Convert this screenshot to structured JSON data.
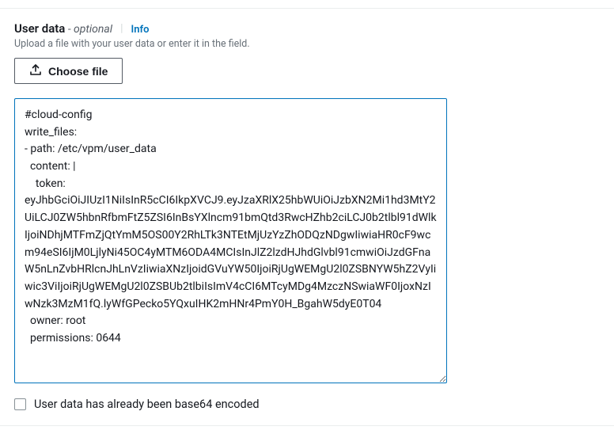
{
  "field": {
    "label": "User data",
    "optional": "- optional",
    "info": "Info",
    "description": "Upload a file with your user data or enter it in the field."
  },
  "choose_file": {
    "label": "Choose file"
  },
  "textarea": {
    "value": "#cloud-config\nwrite_files:\n- path: /etc/vpm/user_data\n  content: |\n    token: eyJhbGciOiJIUzI1NiIsInR5cCI6IkpXVCJ9.eyJzaXRlX25hbWUiOiJzbXN2Mi1hd3MtY2UiLCJ0ZW5hbnRfbmFtZ5ZSI6InBsYXlncm91bmQtd3RwcHZhb2ciLCJ0b2tlbl91dWlkIjoiNDhjMTFmZjQtYmM5OS00Y2RhLTk3NTEtMjUzYzZhODQzNDgwIiwiaHR0cF9wcm94eSI6IjM0LjlyNi45OC4yMTM6ODA4MCIsInJlZ2lzdHJhdGlvbl91cmwiOiJzdGFnaW5nLnZvbHRlcnJhLnVzIiwiaXNzIjoidGVuYW50IjoiRjUgWEMgU2l0ZSBNYW5hZ2VyIiwic3ViIjoiRjUgWEMgU2l0ZSBUb2tlbiIsImV4cCI6MTcyMDg4MzczNSwiaWF0IjoxNzIwNzk3MzM1fQ.lyWfGPecko5YQxuIHK2mHNr4PmY0H_BgahW5dyE0T04\n  owner: root\n  permissions: 0644"
  },
  "checkbox": {
    "label": "User data has already been base64 encoded",
    "checked": false
  }
}
